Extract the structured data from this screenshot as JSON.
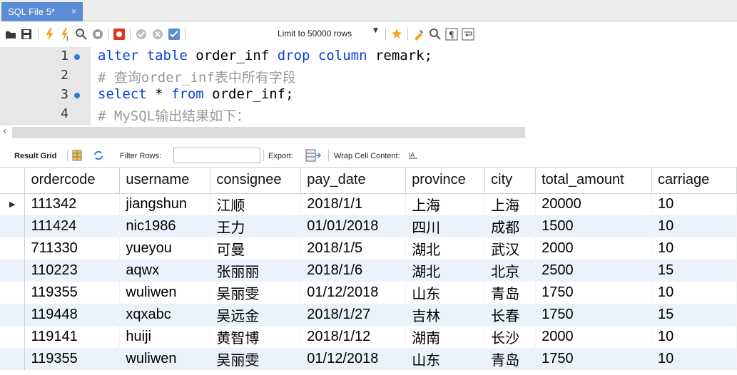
{
  "tab": {
    "title": "SQL File 5*",
    "close_glyph": "×"
  },
  "toolbar": {
    "icons": [
      "folder-open-icon",
      "save-icon",
      "execute-icon",
      "execute-current-icon",
      "explain-icon",
      "stop-icon",
      "toggle-continue-icon",
      "commit-icon",
      "rollback-icon",
      "autocommit-icon",
      "beautify-icon",
      "find-icon",
      "invisible-chars-icon",
      "wrap-icon"
    ],
    "limit_label": "Limit to 50000 rows",
    "accent": "#f5a623"
  },
  "editor": {
    "lines": [
      {
        "num": "1",
        "has_dot": true
      },
      {
        "num": "2",
        "has_dot": false
      },
      {
        "num": "3",
        "has_dot": true
      },
      {
        "num": "4",
        "has_dot": false
      }
    ],
    "line1": {
      "k1": "alter table",
      "t1": " order_inf ",
      "k2": "drop column",
      "t2": " remark;"
    },
    "line2": "# 查询order_inf表中所有字段",
    "line3": {
      "k1": "select",
      "t1": " * ",
      "k2": "from",
      "t2": " order_inf;"
    },
    "line4": "# MySQL输出结果如下："
  },
  "result_toolbar": {
    "result_grid": "Result Grid",
    "filter_rows": "Filter Rows:",
    "filter_value": "",
    "export": "Export:",
    "wrap": "Wrap Cell Content:"
  },
  "grid": {
    "columns": [
      "ordercode",
      "username",
      "consignee",
      "pay_date",
      "province",
      "city",
      "total_amount",
      "carriage"
    ],
    "rows": [
      [
        "111342",
        "jiangshun",
        "江顺",
        "2018/1/1",
        "上海",
        "上海",
        "20000",
        "10"
      ],
      [
        "111424",
        "nic1986",
        "王力",
        "01/01/2018",
        "四川",
        "成都",
        "1500",
        "10"
      ],
      [
        "711330",
        "yueyou",
        "可曼",
        "2018/1/5",
        "湖北",
        "武汉",
        "2000",
        "10"
      ],
      [
        "110223",
        "aqwx",
        "张丽丽",
        "2018/1/6",
        "湖北",
        "北京",
        "2500",
        "15"
      ],
      [
        "119355",
        "wuliwen",
        "吴丽雯",
        "01/12/2018",
        "山东",
        "青岛",
        "1750",
        "10"
      ],
      [
        "119448",
        "xqxabc",
        "吴远金",
        "2018/1/27",
        "吉林",
        "长春",
        "1750",
        "15"
      ],
      [
        "119141",
        "huiji",
        "黄智博",
        "2018/1/12",
        "湖南",
        "长沙",
        "2000",
        "10"
      ],
      [
        "119355",
        "wuliwen",
        "吴丽雯",
        "01/12/2018",
        "山东",
        "青岛",
        "1750",
        "10"
      ]
    ],
    "current_row_marker": "▶"
  }
}
